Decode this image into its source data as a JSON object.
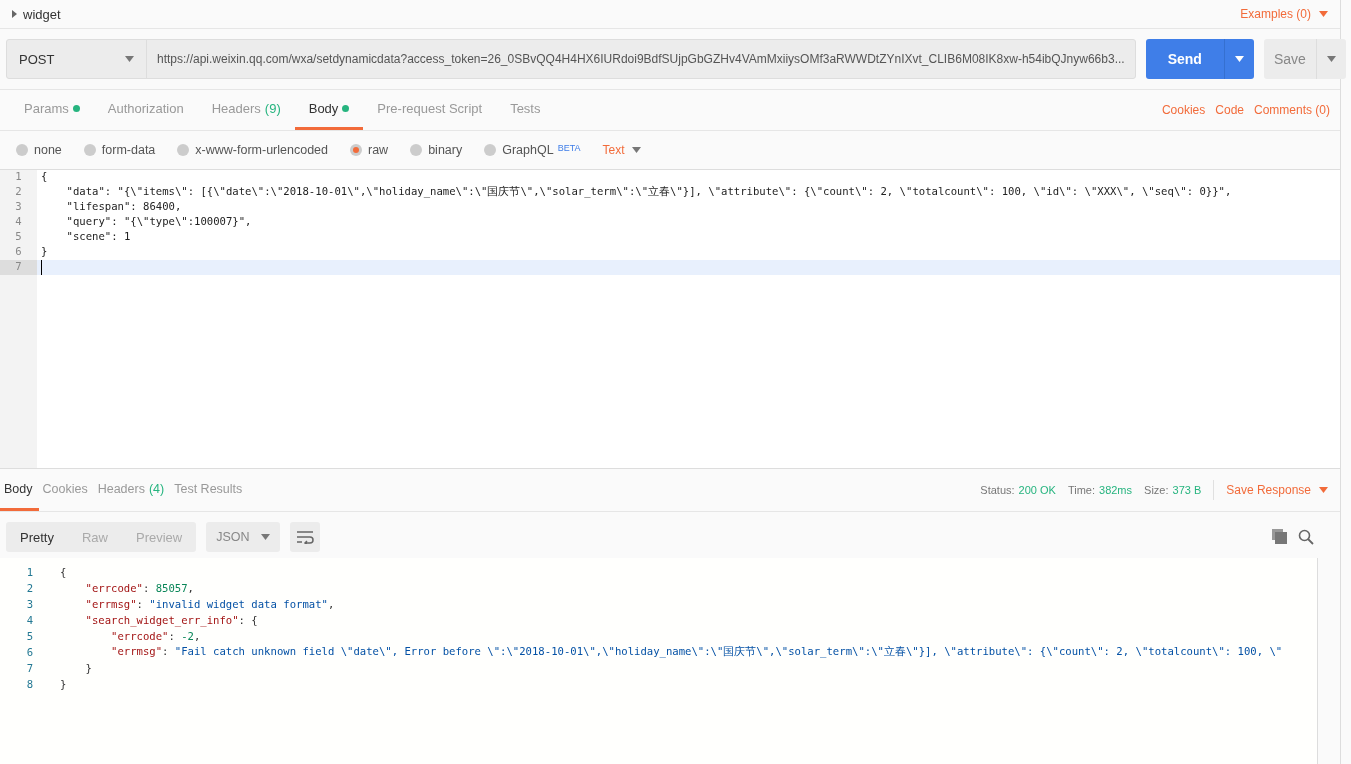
{
  "request_title": "widget",
  "examples_link": "Examples (0)",
  "method": "POST",
  "url": "https://api.weixin.qq.com/wxa/setdynamicdata?access_token=26_0SBvQQ4H4HX6IURdoi9BdfSUjpGbGZHv4VAmMxiiysOMf3aRWWDtZYnIXvt_CLIB6M08IK8xw-h54ibQJnyw66b3...",
  "send_button": "Send",
  "save_button": "Save",
  "request_tabs": [
    {
      "label": "Params",
      "dot": true,
      "selected": false
    },
    {
      "label": "Authorization",
      "dot": false,
      "selected": false
    },
    {
      "label": "Headers",
      "count": "(9)",
      "dot": false,
      "selected": false
    },
    {
      "label": "Body",
      "dot": true,
      "selected": true
    },
    {
      "label": "Pre-request Script",
      "dot": false,
      "selected": false
    },
    {
      "label": "Tests",
      "dot": false,
      "selected": false
    }
  ],
  "request_links": [
    "Cookies",
    "Code",
    "Comments (0)"
  ],
  "body_types": [
    {
      "label": "none",
      "selected": false
    },
    {
      "label": "form-data",
      "selected": false
    },
    {
      "label": "x-www-form-urlencoded",
      "selected": false
    },
    {
      "label": "raw",
      "selected": true
    },
    {
      "label": "binary",
      "selected": false
    },
    {
      "label": "GraphQL",
      "badge": "BETA",
      "selected": false
    }
  ],
  "raw_format": "Text",
  "body_lines": [
    {
      "number": "1",
      "text": "{",
      "current": false
    },
    {
      "number": "2",
      "text": "    \"data\": \"{\\\"items\\\": [{\\\"date\\\":\\\"2018-10-01\\\",\\\"holiday_name\\\":\\\"国庆节\\\",\\\"solar_term\\\":\\\"立春\\\"}], \\\"attribute\\\": {\\\"count\\\": 2, \\\"totalcount\\\": 100, \\\"id\\\": \\\"XXX\\\", \\\"seq\\\": 0}}\",",
      "current": false
    },
    {
      "number": "3",
      "text": "    \"lifespan\": 86400,",
      "current": false
    },
    {
      "number": "4",
      "text": "    \"query\": \"{\\\"type\\\":100007}\",",
      "current": false
    },
    {
      "number": "5",
      "text": "    \"scene\": 1",
      "current": false
    },
    {
      "number": "6",
      "text": "}",
      "current": false
    },
    {
      "number": "7",
      "current": true
    }
  ],
  "response_tabs": [
    {
      "label": "Body",
      "selected": true
    },
    {
      "label": "Cookies",
      "selected": false
    },
    {
      "label": "Headers",
      "count": "(4)",
      "selected": false
    },
    {
      "label": "Test Results",
      "selected": false
    }
  ],
  "status": [
    {
      "label": "Status:",
      "value": "200 OK"
    },
    {
      "label": "Time:",
      "value": "382ms"
    },
    {
      "label": "Size:",
      "value": "373 B"
    }
  ],
  "save_response": "Save Response",
  "view_modes": [
    {
      "label": "Pretty",
      "selected": true
    },
    {
      "label": "Raw",
      "selected": false
    },
    {
      "label": "Preview",
      "selected": false
    }
  ],
  "response_format": "JSON",
  "response_lines": [
    {
      "number": "1",
      "tokens": [
        {
          "kind": "punct",
          "text": "{"
        }
      ]
    },
    {
      "number": "2",
      "tokens": [
        {
          "kind": "key",
          "text": "    \"errcode\""
        },
        {
          "kind": "punct",
          "text": ": "
        },
        {
          "kind": "number",
          "text": "85057"
        },
        {
          "kind": "punct",
          "text": ","
        }
      ]
    },
    {
      "number": "3",
      "tokens": [
        {
          "kind": "key",
          "text": "    \"errmsg\""
        },
        {
          "kind": "punct",
          "text": ": "
        },
        {
          "kind": "string",
          "text": "\"invalid widget data format\""
        },
        {
          "kind": "punct",
          "text": ","
        }
      ]
    },
    {
      "number": "4",
      "tokens": [
        {
          "kind": "key",
          "text": "    \"search_widget_err_info\""
        },
        {
          "kind": "punct",
          "text": ": {"
        }
      ]
    },
    {
      "number": "5",
      "tokens": [
        {
          "kind": "key",
          "text": "        \"errcode\""
        },
        {
          "kind": "punct",
          "text": ": "
        },
        {
          "kind": "number",
          "text": "-2"
        },
        {
          "kind": "punct",
          "text": ","
        }
      ]
    },
    {
      "number": "6",
      "tokens": [
        {
          "kind": "key",
          "text": "        \"errmsg\""
        },
        {
          "kind": "punct",
          "text": ": "
        },
        {
          "kind": "string",
          "text": "\"Fail catch unknown field \\\"date\\\", Error before \\\":\\\"2018-10-01\\\",\\\"holiday_name\\\":\\\"国庆节\\\",\\\"solar_term\\\":\\\"立春\\\"}], \\\"attribute\\\": {\\\"count\\\": 2, \\\"totalcount\\\": 100, \\\""
        }
      ]
    },
    {
      "number": "7",
      "tokens": [
        {
          "kind": "punct",
          "text": "    }"
        }
      ]
    },
    {
      "number": "8",
      "tokens": [
        {
          "kind": "punct",
          "text": "}"
        }
      ]
    }
  ]
}
